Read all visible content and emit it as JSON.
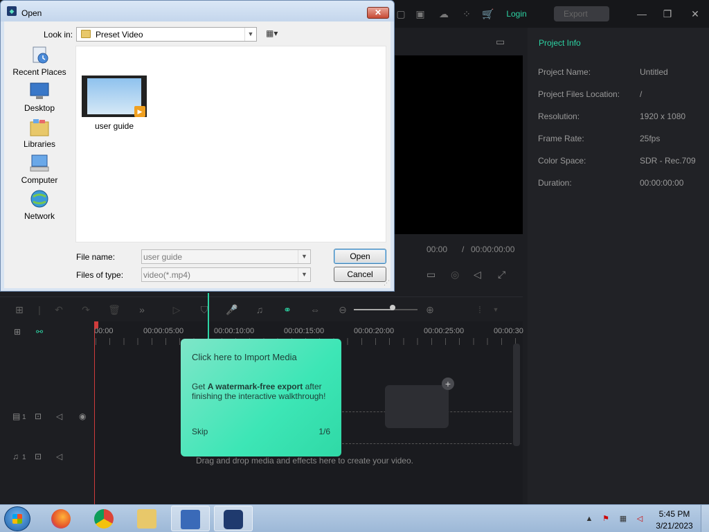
{
  "editor": {
    "login_label": "Login",
    "export_label": "Export",
    "player": {
      "time_current": "00:00",
      "time_separator": "/",
      "time_total": "00:00:00:00"
    },
    "project_info": {
      "tab_label": "Project Info",
      "rows": [
        {
          "key": "Project Name:",
          "value": "Untitled"
        },
        {
          "key": "Project Files Location:",
          "value": "/"
        },
        {
          "key": "Resolution:",
          "value": "1920 x 1080"
        },
        {
          "key": "Frame Rate:",
          "value": "25fps"
        },
        {
          "key": "Color Space:",
          "value": "SDR - Rec.709"
        },
        {
          "key": "Duration:",
          "value": "00:00:00:00"
        }
      ]
    },
    "timeline": {
      "ruler_labels": [
        "00:00",
        "00:00:05:00",
        "00:00:10:00",
        "00:00:15:00",
        "00:00:20:00",
        "00:00:25:00",
        "00:00:30"
      ],
      "video_track_num": "1",
      "audio_track_num": "1",
      "drop_hint": "Drag and drop media and effects here to create your video."
    },
    "guide": {
      "title": "Click here to Import Media",
      "body_prefix": "Get ",
      "body_bold": "A watermark-free export",
      "body_suffix": " after finishing the interactive walkthrough!",
      "skip_label": "Skip",
      "step": "1/6"
    }
  },
  "dialog": {
    "title": "Open",
    "look_in_label": "Look in:",
    "look_in_value": "Preset Video",
    "places": [
      {
        "label": "Recent Places",
        "icon": "recent-places-icon"
      },
      {
        "label": "Desktop",
        "icon": "desktop-icon"
      },
      {
        "label": "Libraries",
        "icon": "libraries-icon"
      },
      {
        "label": "Computer",
        "icon": "computer-icon"
      },
      {
        "label": "Network",
        "icon": "network-icon"
      }
    ],
    "files": [
      {
        "name": "user guide",
        "icon": "video-file-icon"
      }
    ],
    "file_name_label": "File name:",
    "file_name_value": "user guide",
    "file_type_label": "Files of type:",
    "file_type_value": "video(*.mp4)",
    "open_label": "Open",
    "cancel_label": "Cancel"
  },
  "taskbar": {
    "apps": [
      "firefox",
      "chrome",
      "file-explorer",
      "task-manager",
      "filmora"
    ],
    "clock_time": "5:45 PM",
    "clock_date": "3/21/2023"
  },
  "colors": {
    "accent": "#2dd4a4",
    "guide_bg": "#3de6b6",
    "playhead": "#d03c3c"
  }
}
